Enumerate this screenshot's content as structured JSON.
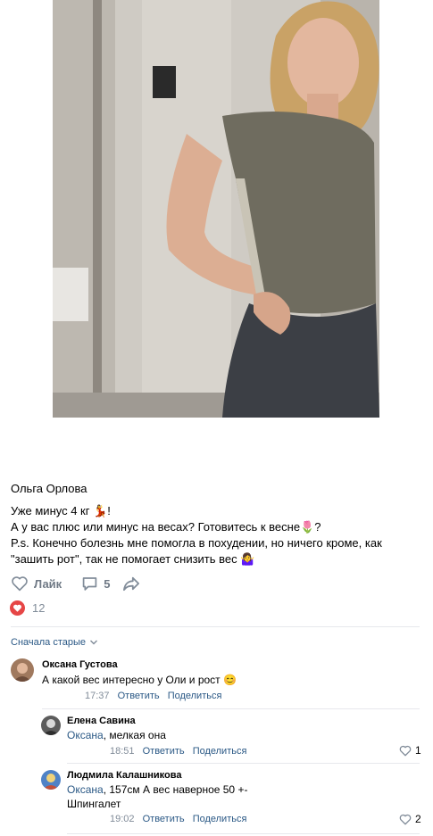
{
  "post": {
    "author": "Ольга Орлова",
    "lines": [
      "Уже минус 4 кг 💃!",
      "А у вас плюс или минус на весах? Готовитесь к весне🌷?",
      "P.s. Конечно болезнь мне помогла в похудении, но ничего кроме, как",
      "\"зашить рот\", так не помогает снизить вес 🤷‍♀️"
    ],
    "like_label": "Лайк",
    "comments_count": "5",
    "likes_total": "12"
  },
  "sort": {
    "label": "Сначала старые"
  },
  "comments": [
    {
      "name": "Оксана Густова",
      "text": "А какой вес интересно у Оли и рост 😊",
      "time": "17:37",
      "reply_label": "Ответить",
      "share_label": "Поделиться"
    }
  ],
  "replies": [
    {
      "name": "Елена Савина",
      "mention": "Оксана",
      "text": ", мелкая она",
      "time": "18:51",
      "reply_label": "Ответить",
      "share_label": "Поделиться",
      "likes": "1"
    },
    {
      "name": "Людмила Калашникова",
      "mention": "Оксана",
      "text": ", 157см А вес наверное 50 +-",
      "text2": "Шпингалет",
      "time": "19:02",
      "reply_label": "Ответить",
      "share_label": "Поделиться",
      "likes": "2"
    }
  ],
  "colors": {
    "link": "#2a5885",
    "meta": "#818c99",
    "heart": "#e64646",
    "divider": "#e7e8ec"
  }
}
